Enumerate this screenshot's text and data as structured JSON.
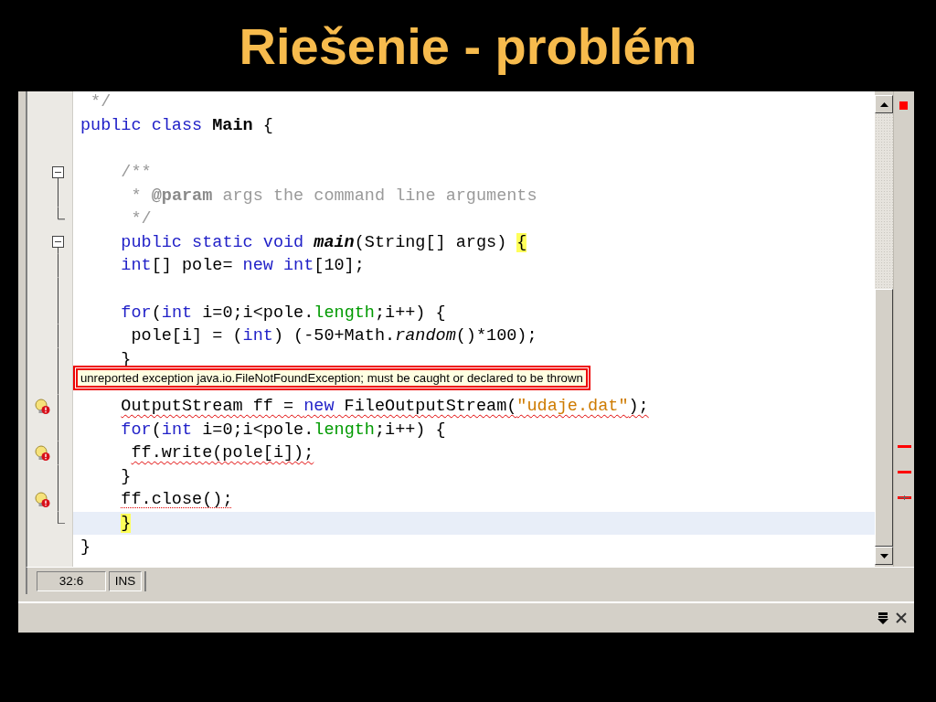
{
  "slide_title": "Riešenie - problém",
  "editor": {
    "lines": [
      {
        "kind": "plain",
        "segments": [
          {
            "text": " */",
            "kind": "comment"
          }
        ]
      },
      {
        "kind": "plain",
        "segments": [
          {
            "text": "public class ",
            "kind": "keyword"
          },
          {
            "text": "Main",
            "kind": "class_name"
          },
          {
            "text": " {",
            "kind": "plain"
          }
        ]
      },
      {
        "kind": "plain"
      },
      {
        "kind": "fold_start",
        "segments": [
          {
            "text": "    /**",
            "kind": "comment"
          }
        ]
      },
      {
        "kind": "fold_body",
        "segments": [
          {
            "text": "     * ",
            "kind": "comment"
          },
          {
            "text": "@param",
            "kind": "comment_tag"
          },
          {
            "text": " args the command line arguments",
            "kind": "comment"
          }
        ]
      },
      {
        "kind": "fold_end",
        "segments": [
          {
            "text": "     */",
            "kind": "comment"
          }
        ]
      },
      {
        "kind": "fold_start",
        "segments": [
          {
            "text": "    public static void ",
            "kind": "keyword"
          },
          {
            "text": "main",
            "kind": "method_decl"
          },
          {
            "text": "(String[] args) ",
            "kind": "plain"
          },
          {
            "text": "{",
            "kind": "matched_brace"
          }
        ]
      },
      {
        "kind": "fold_body",
        "segments": [
          {
            "text": "    int",
            "kind": "keyword"
          },
          {
            "text": "[] pole= ",
            "kind": "plain"
          },
          {
            "text": "new int",
            "kind": "keyword"
          },
          {
            "text": "[10];",
            "kind": "plain"
          }
        ]
      },
      {
        "kind": "fold_body"
      },
      {
        "kind": "fold_body",
        "segments": [
          {
            "text": "    for",
            "kind": "keyword"
          },
          {
            "text": "(",
            "kind": "plain"
          },
          {
            "text": "int",
            "kind": "keyword"
          },
          {
            "text": " i=0;i<pole.",
            "kind": "plain"
          },
          {
            "text": "length",
            "kind": "field"
          },
          {
            "text": ";i++) {",
            "kind": "plain"
          }
        ]
      },
      {
        "kind": "fold_body",
        "segments": [
          {
            "text": "     pole[i] = (",
            "kind": "plain"
          },
          {
            "text": "int",
            "kind": "keyword"
          },
          {
            "text": ") (-50+Math.",
            "kind": "plain"
          },
          {
            "text": "random",
            "kind": "static_method"
          },
          {
            "text": "()*100);",
            "kind": "plain"
          }
        ]
      },
      {
        "kind": "fold_body",
        "segments": [
          {
            "text": "    }",
            "kind": "plain"
          }
        ],
        "tooltip": "unreported exception java.io.FileNotFoundException; must be caught or declared to be thrown"
      },
      {
        "kind": "fold_body"
      },
      {
        "kind": "fold_body",
        "error": true,
        "segments": [
          {
            "text": "    OutputStream ff = ",
            "kind": "plain",
            "wavy_underline": true
          },
          {
            "text": "new",
            "kind": "keyword",
            "wavy_underline": true
          },
          {
            "text": " FileOutputStream(",
            "kind": "plain",
            "wavy_underline": true
          },
          {
            "text": "\"udaje.dat\"",
            "kind": "string",
            "wavy_underline": true
          },
          {
            "text": ");",
            "kind": "plain",
            "wavy_underline": true
          }
        ]
      },
      {
        "kind": "fold_body",
        "error": false,
        "segments": [
          {
            "text": "    for",
            "kind": "keyword"
          },
          {
            "text": "(",
            "kind": "plain"
          },
          {
            "text": "int",
            "kind": "keyword"
          },
          {
            "text": " i=0;i<pole.",
            "kind": "plain"
          },
          {
            "text": "length",
            "kind": "field"
          },
          {
            "text": ";i++) {",
            "kind": "plain"
          }
        ]
      },
      {
        "kind": "fold_body",
        "error": true,
        "segments": [
          {
            "text": "     ff.write(pole[i]);",
            "kind": "plain",
            "wavy_underline": true
          }
        ]
      },
      {
        "kind": "fold_body",
        "error": false,
        "segments": [
          {
            "text": "    }",
            "kind": "plain"
          }
        ]
      },
      {
        "kind": "fold_body",
        "error": true,
        "segments": [
          {
            "text": "    ff.close();",
            "kind": "plain",
            "dotted_underline": true
          }
        ]
      },
      {
        "kind": "fold_end",
        "current": true,
        "segments": [
          {
            "text": "    }",
            "kind": "matched_brace"
          }
        ]
      },
      {
        "kind": "plain",
        "current": false,
        "segments": [
          {
            "text": "}",
            "kind": "plain"
          }
        ]
      }
    ]
  },
  "status_bar": {
    "position": "32:6",
    "mode": "INS"
  }
}
